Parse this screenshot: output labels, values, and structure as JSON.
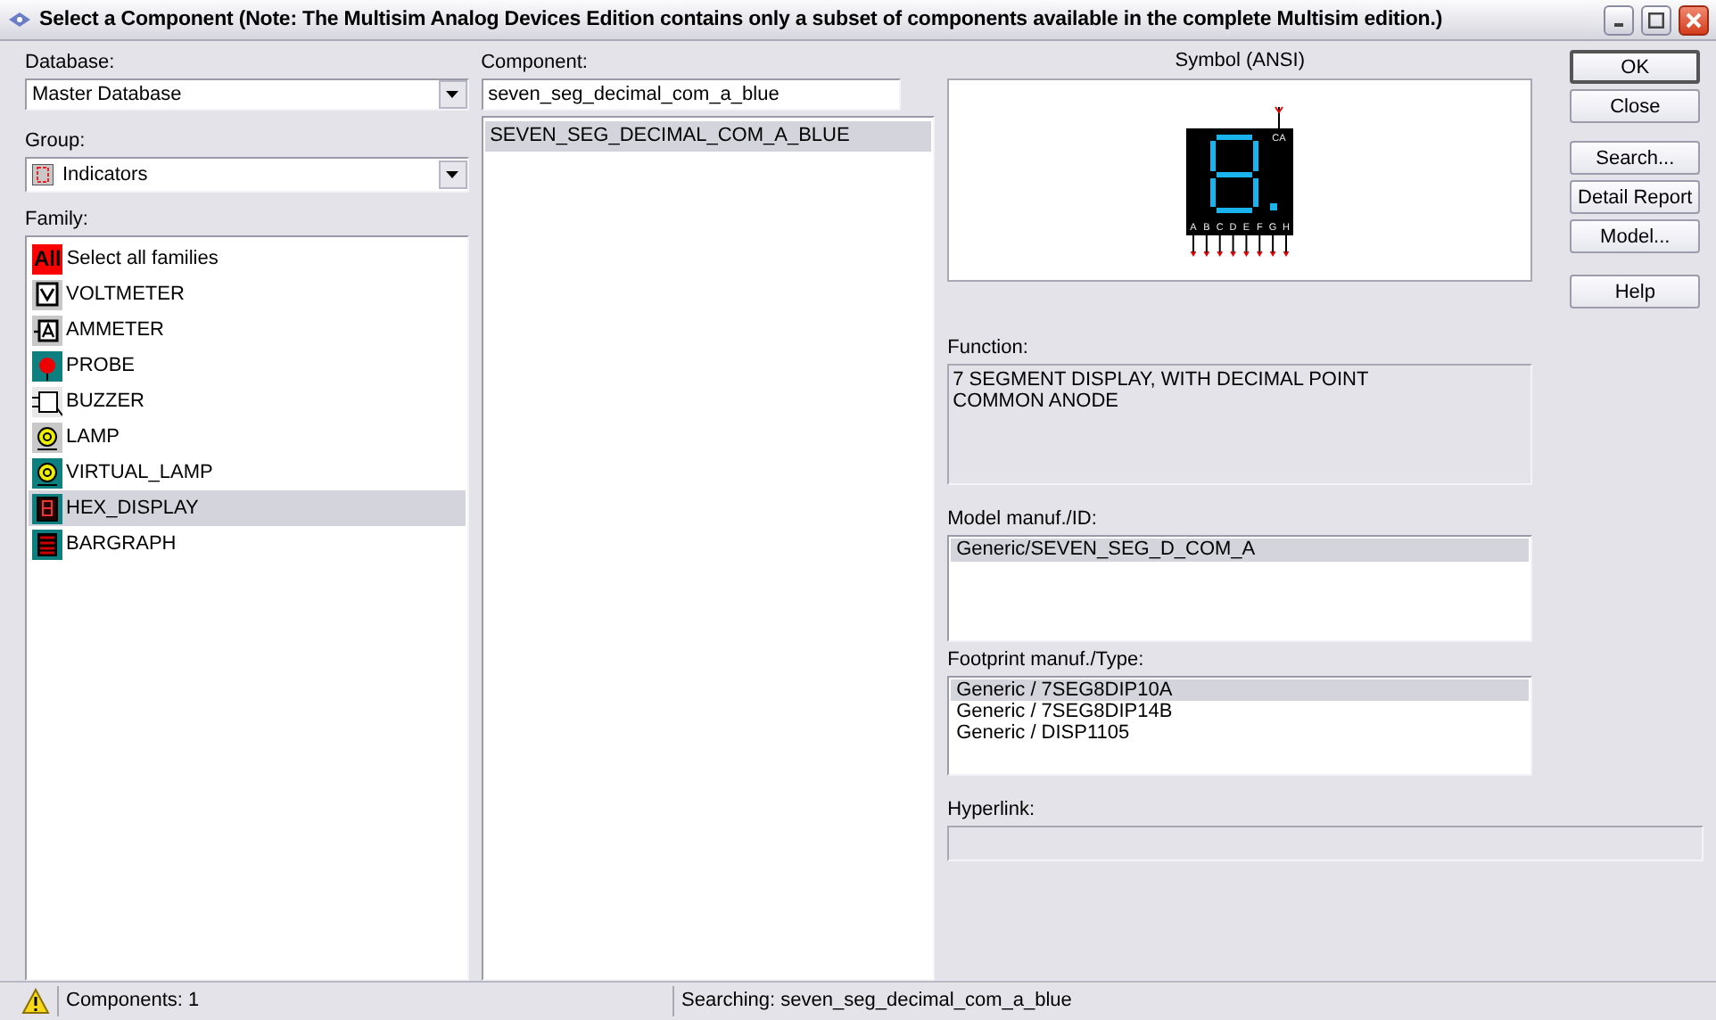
{
  "window": {
    "title": "Select a Component (Note: The Multisim Analog Devices Edition contains only a subset of components available in the complete Multisim edition.)"
  },
  "database": {
    "label": "Database:",
    "value": "Master Database"
  },
  "group": {
    "label": "Group:",
    "value": "Indicators"
  },
  "family": {
    "label": "Family:",
    "items": [
      {
        "kind": "all",
        "badge": "All",
        "label": "Select all families",
        "selected": false
      },
      {
        "kind": "voltmeter",
        "label": "VOLTMETER",
        "selected": false
      },
      {
        "kind": "ammeter",
        "label": "AMMETER",
        "selected": false
      },
      {
        "kind": "probe",
        "label": "PROBE",
        "selected": false
      },
      {
        "kind": "buzzer",
        "label": "BUZZER",
        "selected": false
      },
      {
        "kind": "lamp",
        "label": "LAMP",
        "selected": false
      },
      {
        "kind": "virtual_lamp",
        "label": "VIRTUAL_LAMP",
        "selected": false
      },
      {
        "kind": "hex_display",
        "label": "HEX_DISPLAY",
        "selected": true
      },
      {
        "kind": "bargraph",
        "label": "BARGRAPH",
        "selected": false
      }
    ]
  },
  "component": {
    "label": "Component:",
    "value": "seven_seg_decimal_com_a_blue",
    "items": [
      {
        "label": "SEVEN_SEG_DECIMAL_COM_A_BLUE",
        "selected": true
      }
    ]
  },
  "symbol": {
    "title": "Symbol (ANSI)",
    "common_pin": "CA",
    "pins": [
      "A",
      "B",
      "C",
      "D",
      "E",
      "F",
      "G",
      "H"
    ]
  },
  "function": {
    "label": "Function:",
    "lines": [
      "7 SEGMENT DISPLAY, WITH DECIMAL POINT",
      "COMMON ANODE"
    ]
  },
  "model": {
    "label": "Model manuf./ID:",
    "items": [
      {
        "label": "Generic/SEVEN_SEG_D_COM_A",
        "selected": true
      }
    ]
  },
  "footprint": {
    "label": "Footprint manuf./Type:",
    "items": [
      {
        "label": "Generic / 7SEG8DIP10A",
        "selected": true
      },
      {
        "label": "Generic / 7SEG8DIP14B",
        "selected": false
      },
      {
        "label": "Generic / DISP1105",
        "selected": false
      }
    ]
  },
  "hyperlink": {
    "label": "Hyperlink:"
  },
  "buttons": [
    {
      "label": "OK",
      "default": true
    },
    {
      "label": "Close",
      "default": false
    },
    {
      "label": "Search...",
      "default": false
    },
    {
      "label": "Detail Report",
      "default": false
    },
    {
      "label": "Model...",
      "default": false
    },
    {
      "label": "Help",
      "default": false
    }
  ],
  "status_bar": {
    "count": "Components: 1",
    "message": "Searching: seven_seg_decimal_com_a_blue"
  }
}
